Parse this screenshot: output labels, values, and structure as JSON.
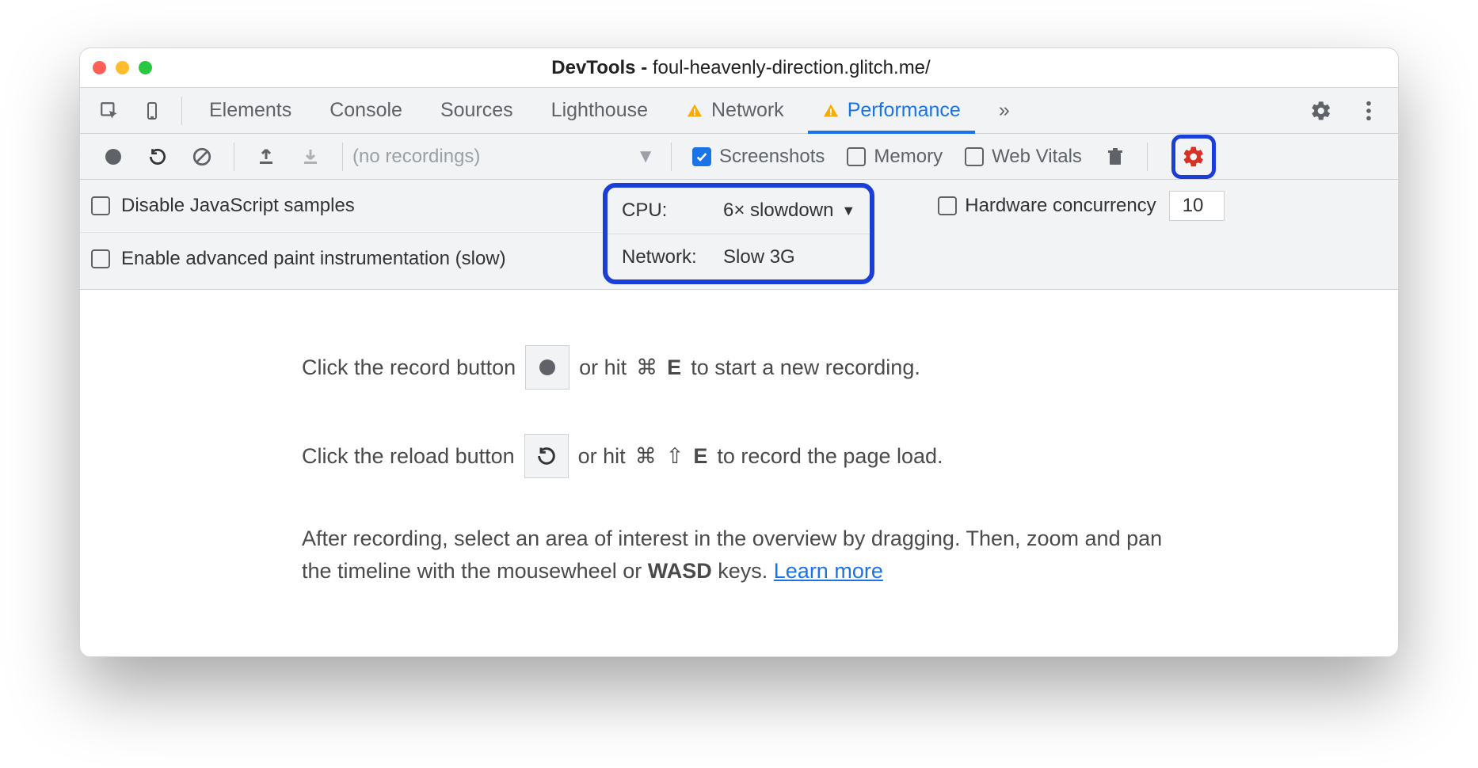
{
  "window": {
    "title_prefix": "DevTools - ",
    "title_url": "foul-heavenly-direction.glitch.me/"
  },
  "tabs": {
    "items": [
      "Elements",
      "Console",
      "Sources",
      "Lighthouse",
      "Network",
      "Performance"
    ],
    "active": "Performance",
    "with_warning": [
      "Network",
      "Performance"
    ],
    "more": "»"
  },
  "toolbar": {
    "recordings_placeholder": "(no recordings)",
    "screenshots": {
      "label": "Screenshots",
      "checked": true
    },
    "memory": {
      "label": "Memory",
      "checked": false
    },
    "webvitals": {
      "label": "Web Vitals",
      "checked": false
    }
  },
  "settings": {
    "disable_js": {
      "label": "Disable JavaScript samples",
      "checked": false
    },
    "paint_instr": {
      "label": "Enable advanced paint instrumentation (slow)",
      "checked": false
    },
    "cpu": {
      "label": "CPU:",
      "value": "6× slowdown"
    },
    "network": {
      "label": "Network:",
      "value": "Slow 3G"
    },
    "hw": {
      "label": "Hardware concurrency",
      "value": "10",
      "checked": false
    }
  },
  "content": {
    "l1a": "Click the record button",
    "l1b": "or hit",
    "l1cmd": "⌘",
    "l1key": "E",
    "l1c": "to start a new recording.",
    "l2a": "Click the reload button",
    "l2b": "or hit",
    "l2cmd": "⌘",
    "l2shift": "⇧",
    "l2key": "E",
    "l2c": "to record the page load.",
    "p1": "After recording, select an area of interest in the overview by dragging. Then, zoom and pan the timeline with the mousewheel or ",
    "p1kbd": "WASD",
    "p1b": " keys. ",
    "learn": "Learn more"
  }
}
